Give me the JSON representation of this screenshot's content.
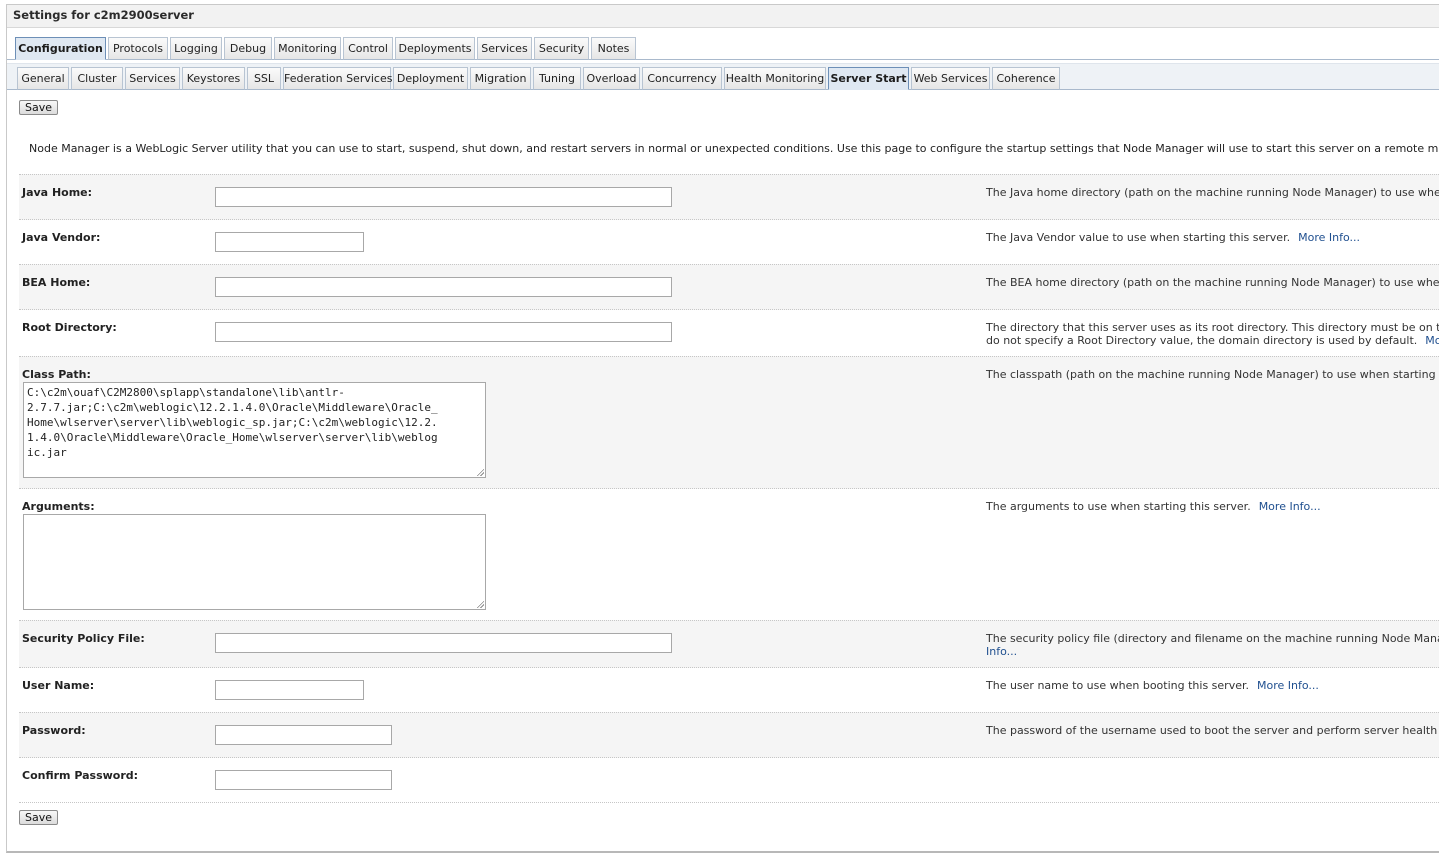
{
  "title": "Settings for c2m2900server",
  "tabs_primary": [
    {
      "label": "Configuration",
      "active": true
    },
    {
      "label": "Protocols",
      "active": false
    },
    {
      "label": "Logging",
      "active": false
    },
    {
      "label": "Debug",
      "active": false
    },
    {
      "label": "Monitoring",
      "active": false
    },
    {
      "label": "Control",
      "active": false
    },
    {
      "label": "Deployments",
      "active": false
    },
    {
      "label": "Services",
      "active": false
    },
    {
      "label": "Security",
      "active": false
    },
    {
      "label": "Notes",
      "active": false
    }
  ],
  "tabs_secondary": [
    {
      "label": "General",
      "active": false
    },
    {
      "label": "Cluster",
      "active": false
    },
    {
      "label": "Services",
      "active": false
    },
    {
      "label": "Keystores",
      "active": false
    },
    {
      "label": "SSL",
      "active": false
    },
    {
      "label": "Federation Services",
      "active": false
    },
    {
      "label": "Deployment",
      "active": false
    },
    {
      "label": "Migration",
      "active": false
    },
    {
      "label": "Tuning",
      "active": false
    },
    {
      "label": "Overload",
      "active": false
    },
    {
      "label": "Concurrency",
      "active": false
    },
    {
      "label": "Health Monitoring",
      "active": false
    },
    {
      "label": "Server Start",
      "active": true
    },
    {
      "label": "Web Services",
      "active": false
    },
    {
      "label": "Coherence",
      "active": false
    }
  ],
  "save_label": "Save",
  "intro": "Node Manager is a WebLogic Server utility that you can use to start, suspend, shut down, and restart servers in normal or unexpected conditions. Use this page to configure the startup settings that Node Manager will use to start this server on a remote machine.",
  "more_info": "More Info...",
  "fields": {
    "java_home": {
      "label": "Java Home:",
      "value": "",
      "help": "The Java home directory (path on the machine running Node Manager) to use when starting"
    },
    "java_vendor": {
      "label": "Java Vendor:",
      "value": "",
      "help": "The Java Vendor value to use when starting this server."
    },
    "bea_home": {
      "label": "BEA Home:",
      "value": "",
      "help": "The BEA home directory (path on the machine running Node Manager) to use when starting t"
    },
    "root_directory": {
      "label": "Root Directory:",
      "value": "",
      "help_line1": "The directory that this server uses as its root directory. This directory must be on the comput",
      "help_line2": "do not specify a Root Directory value, the domain directory is used by default."
    },
    "class_path": {
      "label": "Class Path:",
      "value": "C:\\c2m\\ouaf\\C2M2800\\splapp\\standalone\\lib\\antlr-\n2.7.7.jar;C:\\c2m\\weblogic\\12.2.1.4.0\\Oracle\\Middleware\\Oracle_\nHome\\wlserver\\server\\lib\\weblogic_sp.jar;C:\\c2m\\weblogic\\12.2.\n1.4.0\\Oracle\\Middleware\\Oracle_Home\\wlserver\\server\\lib\\weblog\nic.jar",
      "help": "The classpath (path on the machine running Node Manager) to use when starting this server."
    },
    "arguments": {
      "label": "Arguments:",
      "value": "",
      "help": "The arguments to use when starting this server."
    },
    "security_policy_file": {
      "label": "Security Policy File:",
      "value": "",
      "help_line1": "The security policy file (directory and filename on the machine running Node Manager) to use",
      "help_line2": "Info..."
    },
    "user_name": {
      "label": "User Name:",
      "value": "",
      "help": "The user name to use when booting this server."
    },
    "password": {
      "label": "Password:",
      "value": "",
      "help": "The password of the username used to boot the server and perform server health monitoring"
    },
    "confirm_password": {
      "label": "Confirm Password:",
      "value": ""
    }
  }
}
